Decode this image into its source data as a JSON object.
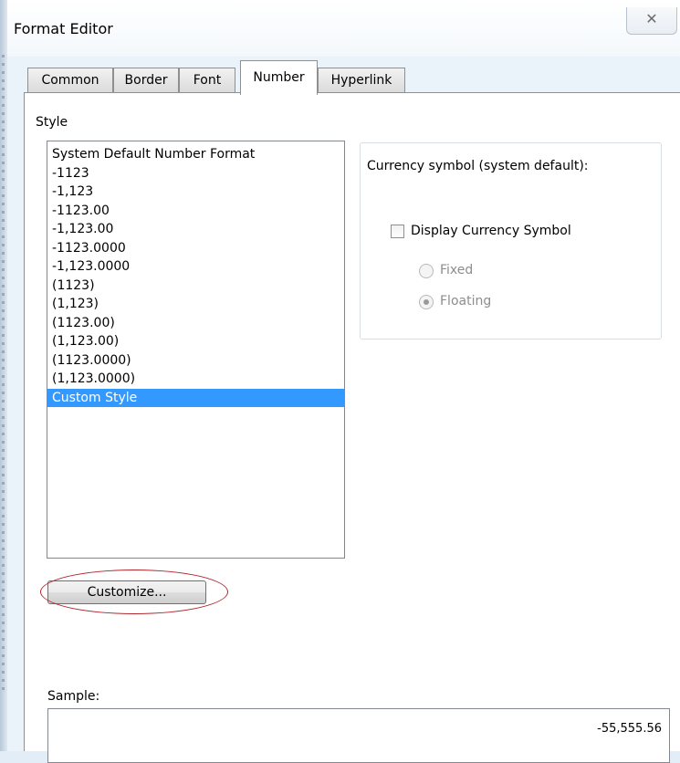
{
  "window": {
    "title": "Format Editor",
    "close_glyph": "✕"
  },
  "tabs": [
    {
      "label": "Common",
      "active": false
    },
    {
      "label": "Border",
      "active": false
    },
    {
      "label": "Font",
      "active": false
    },
    {
      "label": "Number",
      "active": true
    },
    {
      "label": "Hyperlink",
      "active": false
    }
  ],
  "style": {
    "label": "Style",
    "items": [
      "System Default Number Format",
      "-1123",
      "-1,123",
      "-1123.00",
      "-1,123.00",
      "-1123.0000",
      "-1,123.0000",
      "(1123)",
      "(1,123)",
      "(1123.00)",
      "(1,123.00)",
      "(1123.0000)",
      "(1,123.0000)",
      "Custom Style"
    ],
    "selected": "Custom Style"
  },
  "currency": {
    "title": "Currency symbol (system default):",
    "display_label": "Display Currency Symbol",
    "display_checked": false,
    "fixed_label": "Fixed",
    "floating_label": "Floating",
    "selected": "Floating",
    "disabled": true
  },
  "buttons": {
    "customize_label": "Customize..."
  },
  "sample": {
    "label": "Sample:",
    "value": "-55,555.56"
  },
  "colors": {
    "selection": "#3399ff",
    "annotation": "#b0272c",
    "disabled_text": "#8d8d8d"
  }
}
